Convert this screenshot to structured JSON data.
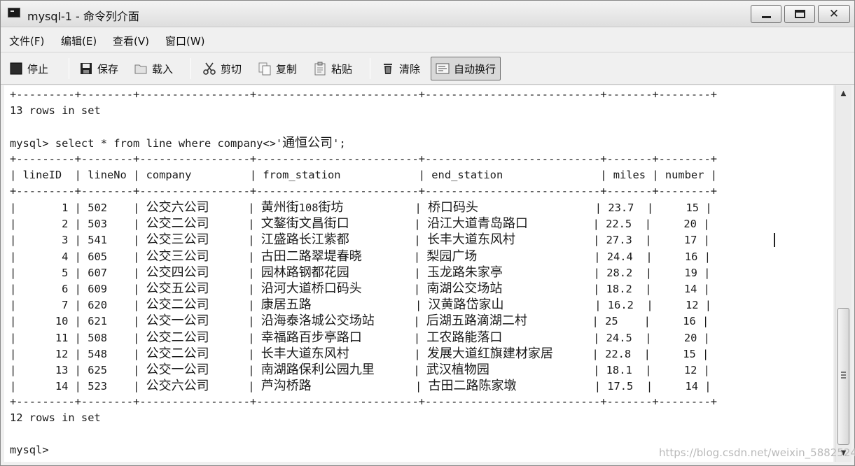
{
  "window": {
    "title": "mysql-1 - 命令列介面",
    "controls": {
      "minimize": "minimize",
      "maximize": "maximize",
      "close": "✕"
    }
  },
  "menu": [
    {
      "label": "文件(F)"
    },
    {
      "label": "编辑(E)"
    },
    {
      "label": "查看(V)"
    },
    {
      "label": "窗口(W)"
    }
  ],
  "toolbar": {
    "stop": "停止",
    "save": "保存",
    "load": "载入",
    "cut": "剪切",
    "copy": "复制",
    "paste": "粘贴",
    "clear": "清除",
    "wrap": "自动换行"
  },
  "console": {
    "border": "+---------+--------+-----------------+-------------------------+---------------------------+-------+--------+",
    "prev_result": "13 rows in set",
    "query_prefix": "mysql> select * from line where company<>'",
    "query_literal": "通恒公司",
    "query_suffix": "';",
    "header": [
      "lineID",
      "lineNo",
      "company",
      "from_station",
      "end_station",
      "miles",
      "number"
    ],
    "rows": [
      [
        "1",
        "502",
        "公交六公司",
        "黄州街108街坊",
        "桥口码头",
        "23.7",
        "15"
      ],
      [
        "2",
        "503",
        "公交二公司",
        "文鏊街文昌街口",
        "沿江大道青岛路口",
        "22.5",
        "20"
      ],
      [
        "3",
        "541",
        "公交三公司",
        "江盛路长江紫都",
        "长丰大道东风村",
        "27.3",
        "17"
      ],
      [
        "4",
        "605",
        "公交三公司",
        "古田二路翠堤春晓",
        "梨园广场",
        "24.4",
        "16"
      ],
      [
        "5",
        "607",
        "公交四公司",
        "园林路钢都花园",
        "玉龙路朱家亭",
        "28.2",
        "19"
      ],
      [
        "6",
        "609",
        "公交五公司",
        "沿河大道桥口码头",
        "南湖公交场站",
        "18.2",
        "14"
      ],
      [
        "7",
        "620",
        "公交二公司",
        "康居五路",
        "汉黄路岱家山",
        "16.2",
        "12"
      ],
      [
        "10",
        "621",
        "公交一公司",
        "沿海泰洛城公交场站",
        "后湖五路滴湖二村",
        "25",
        "16"
      ],
      [
        "11",
        "508",
        "公交二公司",
        "幸福路百步亭路口",
        "工农路能落口",
        "24.5",
        "20"
      ],
      [
        "12",
        "548",
        "公交二公司",
        "长丰大道东风村",
        "发展大道红旗建材家居",
        "22.8",
        "15"
      ],
      [
        "13",
        "625",
        "公交一公司",
        "南湖路保利公园九里",
        "武汉植物园",
        "18.1",
        "12"
      ],
      [
        "14",
        "523",
        "公交六公司",
        "芦沟桥路",
        "古田二路陈家墩",
        "17.5",
        "14"
      ]
    ],
    "result_text": "12 rows in set",
    "prompt": "mysql>"
  },
  "watermark": "https://blog.csdn.net/weixin_5882524"
}
